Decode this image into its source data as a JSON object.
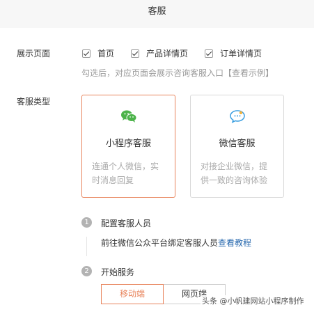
{
  "header": {
    "title": "客服"
  },
  "display_pages": {
    "label": "展示页面",
    "options": [
      {
        "label": "首页",
        "checked": true
      },
      {
        "label": "产品详情页",
        "checked": true
      },
      {
        "label": "订单详情页",
        "checked": true
      }
    ],
    "hint": "勾选后，对应页面会展示咨询客服入口",
    "hint_link": "【查看示例】"
  },
  "service_type": {
    "label": "客服类型",
    "cards": [
      {
        "title": "小程序客服",
        "desc_line1": "连通个人微信，实",
        "desc_line2": "时消息回复",
        "icon": "wechat-icon",
        "selected": true
      },
      {
        "title": "微信客服",
        "desc_line1": "对接企业微信，提",
        "desc_line2": "供一致的咨询体验",
        "icon": "chat-bubble-icon",
        "selected": false
      }
    ]
  },
  "steps": [
    {
      "number": "1",
      "title": "配置客服人员",
      "desc_prefix": "前往微信公众平台绑定客服人员",
      "desc_link": "查看教程"
    },
    {
      "number": "2",
      "title": "开始服务"
    }
  ],
  "segment": {
    "options": [
      "移动端",
      "网页端"
    ],
    "active": "移动端"
  },
  "watermark": "头条 @小帆建网站小程序制作",
  "colors": {
    "accent": "#e8845c",
    "link": "#2a6aaf",
    "muted": "#999999"
  }
}
